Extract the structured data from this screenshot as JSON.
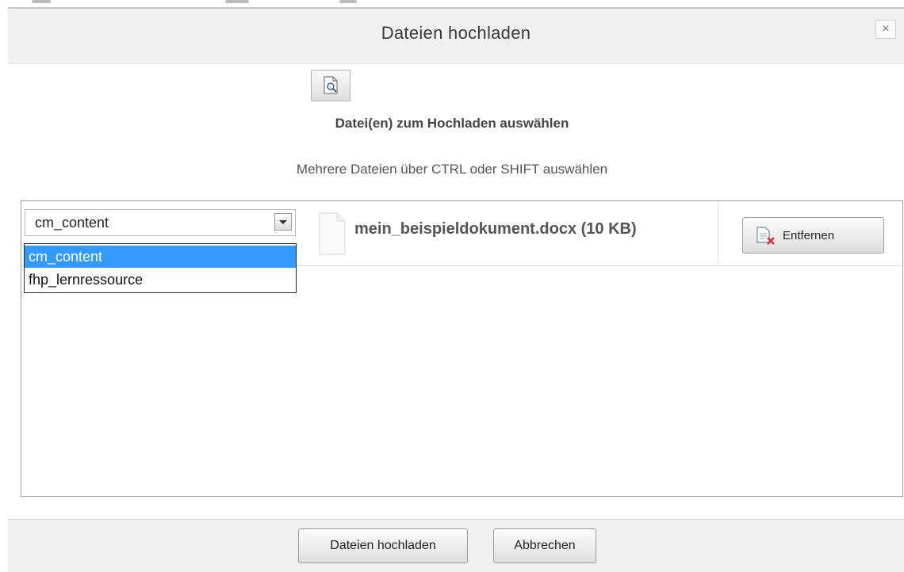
{
  "dialog": {
    "title": "Dateien hochladen",
    "close_label": "×"
  },
  "upload": {
    "browse_icon": "document-search-icon",
    "select_label": "Datei(en) zum Hochladen auswählen",
    "hint": "Mehrere Dateien über CTRL oder SHIFT auswählen"
  },
  "file_row": {
    "type_select": {
      "value": "cm_content",
      "options": [
        "cm_content",
        "fhp_lernressource"
      ],
      "highlighted_option": "cm_content"
    },
    "file_icon": "document-icon",
    "file_name": "mein_beispieldokument.docx (10 KB)",
    "remove_icon": "document-remove-icon",
    "remove_label": "Entfernen"
  },
  "footer": {
    "upload_label": "Dateien hochladen",
    "cancel_label": "Abbrechen"
  },
  "colors": {
    "highlight": "#3399ff",
    "panel_background": "#f0f0f0",
    "remove_accent": "#e03030"
  }
}
